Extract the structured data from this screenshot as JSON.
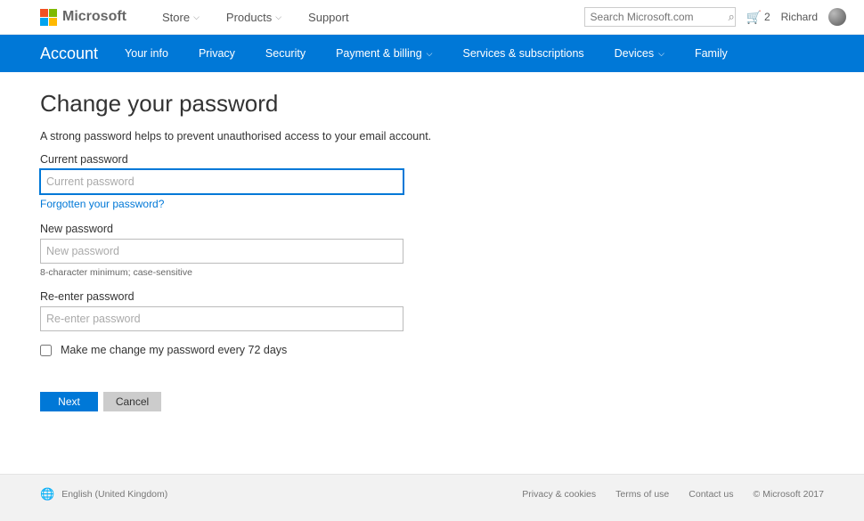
{
  "header": {
    "brand": "Microsoft",
    "nav": {
      "store": "Store",
      "products": "Products",
      "support": "Support"
    },
    "search_placeholder": "Search Microsoft.com",
    "cart_count": "2",
    "user_name": "Richard"
  },
  "bluebar": {
    "title": "Account",
    "items": {
      "your_info": "Your info",
      "privacy": "Privacy",
      "security": "Security",
      "payment": "Payment & billing",
      "services": "Services & subscriptions",
      "devices": "Devices",
      "family": "Family"
    }
  },
  "page": {
    "title": "Change your password",
    "subtext": "A strong password helps to prevent unauthorised access to your email account.",
    "current_label": "Current password",
    "current_placeholder": "Current password",
    "forgot_link": "Forgotten your password?",
    "new_label": "New password",
    "new_placeholder": "New password",
    "new_hint": "8-character minimum; case-sensitive",
    "reenter_label": "Re-enter password",
    "reenter_placeholder": "Re-enter password",
    "checkbox_label": "Make me change my password every 72 days",
    "next_btn": "Next",
    "cancel_btn": "Cancel"
  },
  "footer": {
    "locale": "English (United Kingdom)",
    "privacy": "Privacy & cookies",
    "terms": "Terms of use",
    "contact": "Contact us",
    "copyright": "© Microsoft 2017"
  }
}
